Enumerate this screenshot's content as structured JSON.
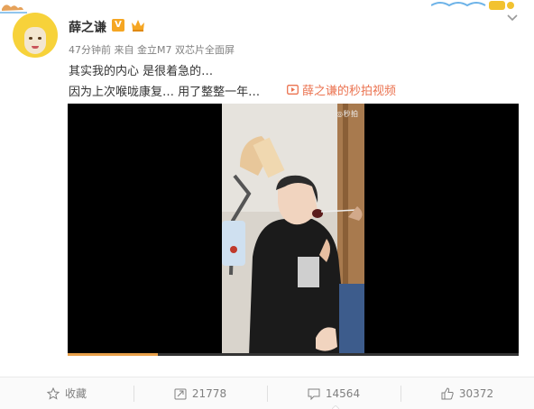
{
  "user": {
    "name": "薛之谦",
    "vip_label": "V"
  },
  "meta": {
    "time": "47分钟前",
    "from_prefix": "来自",
    "source": "金立M7 双芯片全面屏"
  },
  "post": {
    "line1": "其实我的内心  是很着急的…",
    "line2": "因为上次喉咙康复…  用了整整一年…",
    "video_link": "薛之谦的秒拍视频"
  },
  "video": {
    "watermark": "◎秒拍",
    "progress_fraction": 0.2
  },
  "actions": {
    "favorite": "收藏",
    "repost": "21778",
    "comment": "14564",
    "like": "30372"
  },
  "colors": {
    "link": "#eb7350",
    "vip": "#f5a623",
    "avatar": "#f7d23a"
  },
  "icons": [
    "star-icon",
    "repost-icon",
    "comment-icon",
    "thumbs-up-icon",
    "chevron-down-icon",
    "video-play-icon",
    "crown-icon"
  ]
}
